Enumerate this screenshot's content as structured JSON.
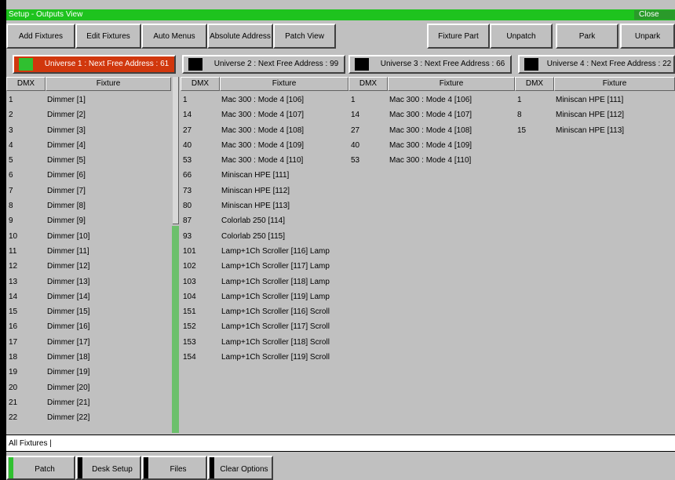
{
  "window": {
    "title": "Setup - Outputs View",
    "close_label": "Close"
  },
  "toolbar": {
    "add_fixtures": "Add Fixtures",
    "edit_fixtures": "Edit Fixtures",
    "auto_menus": "Auto Menus",
    "absolute_address": "Absolute Address",
    "patch_view": "Patch View",
    "fixture_part": "Fixture Part",
    "unpatch": "Unpatch",
    "park": "Park",
    "unpark": "Unpark"
  },
  "universes": [
    {
      "label": "Universe 1 : Next Free Address : 61",
      "active": true,
      "swatch_color": "#30c030"
    },
    {
      "label": "Universe 2 : Next Free Address : 99",
      "active": false,
      "swatch_color": "#000000"
    },
    {
      "label": "Universe 3 : Next Free Address : 66",
      "active": false,
      "swatch_color": "#000000"
    },
    {
      "label": "Universe 4 : Next Free Address : 22",
      "active": false,
      "swatch_color": "#000000"
    }
  ],
  "columns": {
    "dmx": "DMX",
    "fixture": "Fixture"
  },
  "panel1": [
    {
      "dmx": "1",
      "fixture": "Dimmer [1]"
    },
    {
      "dmx": "2",
      "fixture": "Dimmer [2]"
    },
    {
      "dmx": "3",
      "fixture": "Dimmer [3]"
    },
    {
      "dmx": "4",
      "fixture": "Dimmer [4]"
    },
    {
      "dmx": "5",
      "fixture": "Dimmer [5]"
    },
    {
      "dmx": "6",
      "fixture": "Dimmer [6]"
    },
    {
      "dmx": "7",
      "fixture": "Dimmer [7]"
    },
    {
      "dmx": "8",
      "fixture": "Dimmer [8]"
    },
    {
      "dmx": "9",
      "fixture": "Dimmer [9]"
    },
    {
      "dmx": "10",
      "fixture": "Dimmer [10]"
    },
    {
      "dmx": "11",
      "fixture": "Dimmer [11]"
    },
    {
      "dmx": "12",
      "fixture": "Dimmer [12]"
    },
    {
      "dmx": "13",
      "fixture": "Dimmer [13]"
    },
    {
      "dmx": "14",
      "fixture": "Dimmer [14]"
    },
    {
      "dmx": "15",
      "fixture": "Dimmer [15]"
    },
    {
      "dmx": "16",
      "fixture": "Dimmer [16]"
    },
    {
      "dmx": "17",
      "fixture": "Dimmer [17]"
    },
    {
      "dmx": "18",
      "fixture": "Dimmer [18]"
    },
    {
      "dmx": "19",
      "fixture": "Dimmer [19]"
    },
    {
      "dmx": "20",
      "fixture": "Dimmer [20]"
    },
    {
      "dmx": "21",
      "fixture": "Dimmer [21]"
    },
    {
      "dmx": "22",
      "fixture": "Dimmer [22]"
    }
  ],
  "panel2": [
    {
      "dmx": "1",
      "fixture": "Mac 300 : Mode 4 [106]"
    },
    {
      "dmx": "14",
      "fixture": "Mac 300 : Mode 4 [107]"
    },
    {
      "dmx": "27",
      "fixture": "Mac 300 : Mode 4 [108]"
    },
    {
      "dmx": "40",
      "fixture": "Mac 300 : Mode 4 [109]"
    },
    {
      "dmx": "53",
      "fixture": "Mac 300 : Mode 4 [110]"
    },
    {
      "dmx": "66",
      "fixture": "Miniscan HPE [111]"
    },
    {
      "dmx": "73",
      "fixture": "Miniscan HPE [112]"
    },
    {
      "dmx": "80",
      "fixture": "Miniscan HPE [113]"
    },
    {
      "dmx": "87",
      "fixture": "Colorlab 250 [114]"
    },
    {
      "dmx": "93",
      "fixture": "Colorlab 250 [115]"
    },
    {
      "dmx": "101",
      "fixture": "Lamp+1Ch Scroller [116] Lamp"
    },
    {
      "dmx": "102",
      "fixture": "Lamp+1Ch Scroller [117] Lamp"
    },
    {
      "dmx": "103",
      "fixture": "Lamp+1Ch Scroller [118] Lamp"
    },
    {
      "dmx": "104",
      "fixture": "Lamp+1Ch Scroller [119] Lamp"
    },
    {
      "dmx": "151",
      "fixture": "Lamp+1Ch Scroller [116] Scroll"
    },
    {
      "dmx": "152",
      "fixture": "Lamp+1Ch Scroller [117] Scroll"
    },
    {
      "dmx": "153",
      "fixture": "Lamp+1Ch Scroller [118] Scroll"
    },
    {
      "dmx": "154",
      "fixture": "Lamp+1Ch Scroller [119] Scroll"
    }
  ],
  "panel3": [
    {
      "dmx": "1",
      "fixture": "Mac 300 : Mode 4 [106]"
    },
    {
      "dmx": "14",
      "fixture": "Mac 300 : Mode 4 [107]"
    },
    {
      "dmx": "27",
      "fixture": "Mac 300 : Mode 4 [108]"
    },
    {
      "dmx": "40",
      "fixture": "Mac 300 : Mode 4 [109]"
    },
    {
      "dmx": "53",
      "fixture": "Mac 300 : Mode 4 [110]"
    }
  ],
  "panel4": [
    {
      "dmx": "1",
      "fixture": "Miniscan HPE [111]"
    },
    {
      "dmx": "8",
      "fixture": "Miniscan HPE [112]"
    },
    {
      "dmx": "15",
      "fixture": "Miniscan HPE [113]"
    }
  ],
  "command_line": "All Fixtures |",
  "bottom_buttons": [
    {
      "label": "Patch",
      "indicator_color": "#30c030"
    },
    {
      "label": "Desk Setup",
      "indicator_color": "#000000"
    },
    {
      "label": "Files",
      "indicator_color": "#000000"
    },
    {
      "label": "Clear Options",
      "indicator_color": "#000000"
    }
  ]
}
